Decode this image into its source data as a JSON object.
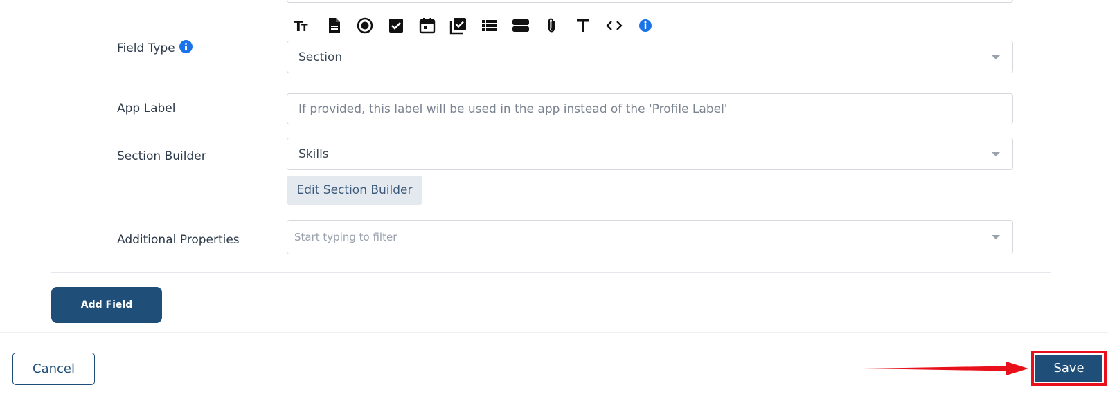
{
  "form": {
    "field_type": {
      "label": "Field Type",
      "toolbar_icons": [
        "text-size-icon",
        "document-icon",
        "radio-icon",
        "checkbox-icon",
        "calendar-icon",
        "multi-checkbox-icon",
        "list-icon",
        "section-icon",
        "paperclip-icon",
        "text-icon",
        "code-icon",
        "info-icon"
      ],
      "value": "Section"
    },
    "app_label": {
      "label": "App Label",
      "placeholder": "If provided, this label will be used in the app instead of the 'Profile Label'"
    },
    "section_builder": {
      "label": "Section Builder",
      "value": "Skills",
      "edit_button": "Edit Section Builder"
    },
    "additional_properties": {
      "label": "Additional Properties",
      "placeholder": "Start typing to filter"
    }
  },
  "actions": {
    "add_field": "Add Field",
    "cancel": "Cancel",
    "save": "Save"
  },
  "colors": {
    "primary": "#1f4e79",
    "info": "#1a73e8",
    "highlight": "#e8101a"
  }
}
